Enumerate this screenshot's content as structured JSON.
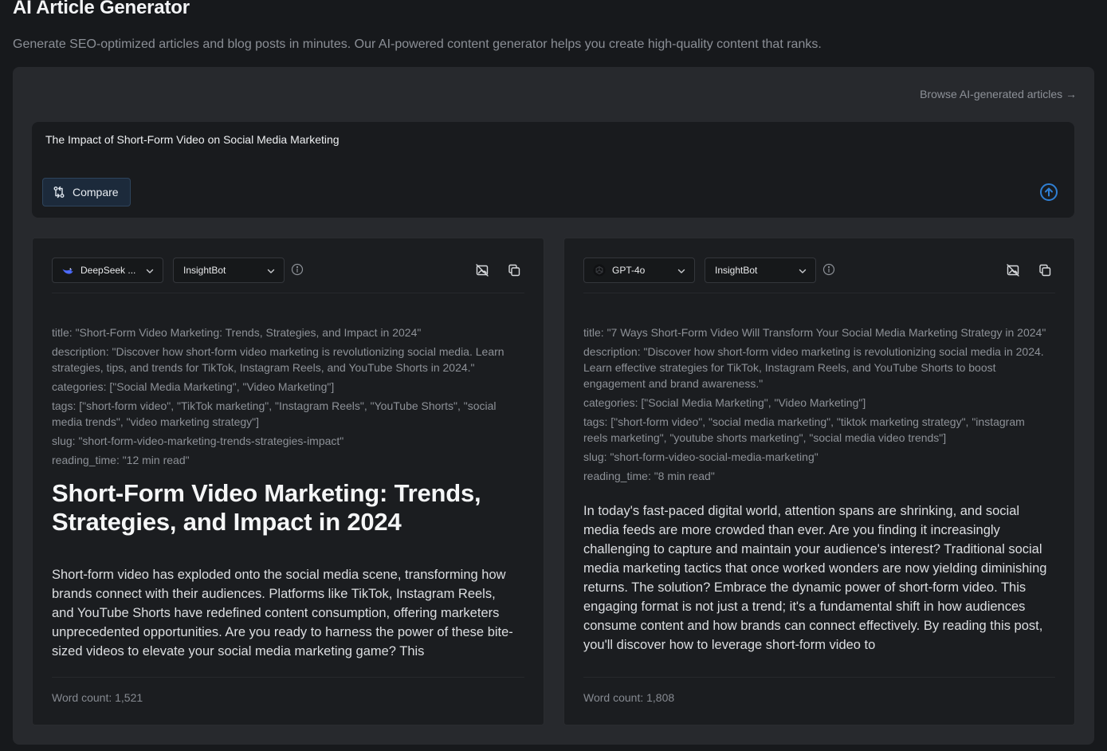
{
  "header": {
    "title": "AI Article Generator",
    "subtitle": "Generate SEO-optimized articles and blog posts in minutes. Our AI-powered content generator helps you create high-quality content that ranks."
  },
  "browse_link": "Browse AI-generated articles →",
  "prompt": {
    "value": "The Impact of Short-Form Video on Social Media Marketing",
    "compare_label": "Compare",
    "submit_icon": "arrow-up-circle-icon"
  },
  "colors": {
    "accent": "#2f7fd3",
    "background": "#17191c",
    "panel": "#27292d",
    "card": "#1b1d20"
  },
  "results": [
    {
      "model_label": "DeepSeek ...",
      "model_icon": "deepseek-whale-icon",
      "bot_label": "InsightBot",
      "meta": [
        "title: \"Short-Form Video Marketing: Trends, Strategies, and Impact in 2024\"",
        "description: \"Discover how short-form video marketing is revolutionizing social media. Learn strategies, tips, and trends for TikTok, Instagram Reels, and YouTube Shorts in 2024.\"",
        "categories: [\"Social Media Marketing\", \"Video Marketing\"]",
        "tags: [\"short-form video\", \"TikTok marketing\", \"Instagram Reels\", \"YouTube Shorts\", \"social media trends\", \"video marketing strategy\"]",
        "slug: \"short-form-video-marketing-trends-strategies-impact\"",
        "reading_time: \"12 min read\""
      ],
      "heading": "Short-Form Video Marketing: Trends, Strategies, and Impact in 2024",
      "body": "Short-form video has exploded onto the social media scene, transforming how brands connect with their audiences. Platforms like TikTok, Instagram Reels, and YouTube Shorts have redefined content consumption, offering marketers unprecedented opportunities. Are you ready to harness the power of these bite-sized videos to elevate your social media marketing game? This",
      "word_count": "Word count: 1,521"
    },
    {
      "model_label": "GPT-4o",
      "model_icon": "openai-icon",
      "bot_label": "InsightBot",
      "meta": [
        "title: \"7 Ways Short-Form Video Will Transform Your Social Media Marketing Strategy in 2024\"",
        "description: \"Discover how short-form video marketing is revolutionizing social media in 2024. Learn effective strategies for TikTok, Instagram Reels, and YouTube Shorts to boost engagement and brand awareness.\"",
        "categories: [\"Social Media Marketing\", \"Video Marketing\"]",
        "tags: [\"short-form video\", \"social media marketing\", \"tiktok marketing strategy\", \"instagram reels marketing\", \"youtube shorts marketing\", \"social media video trends\"]",
        "slug: \"short-form-video-social-media-marketing\"",
        "reading_time: \"8 min read\""
      ],
      "body": "In today's fast-paced digital world, attention spans are shrinking, and social media feeds are more crowded than ever. Are you finding it increasingly challenging to capture and maintain your audience's interest? Traditional social media marketing tactics that once worked wonders are now yielding diminishing returns. The solution? Embrace the dynamic power of short-form video. This engaging format is not just a trend; it's a fundamental shift in how audiences consume content and how brands can connect effectively. By reading this post, you'll discover how to leverage short-form video to",
      "word_count": "Word count: 1,808"
    }
  ]
}
